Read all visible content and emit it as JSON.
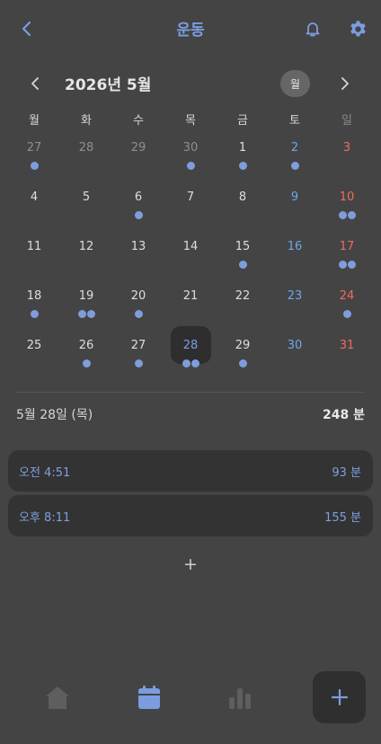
{
  "header": {
    "title": "운동",
    "back_icon": "chevron-left-icon",
    "notification_icon": "bell-icon",
    "settings_icon": "gear-icon"
  },
  "calendar": {
    "month_label": "2026년 5월",
    "view_toggle": "월",
    "weekdays": [
      "월",
      "화",
      "수",
      "목",
      "금",
      "토",
      "일"
    ],
    "weeks": [
      [
        {
          "d": "27",
          "other": true,
          "dots": 1
        },
        {
          "d": "28",
          "other": true,
          "dots": 0
        },
        {
          "d": "29",
          "other": true,
          "dots": 0
        },
        {
          "d": "30",
          "other": true,
          "dots": 1
        },
        {
          "d": "1",
          "dots": 1
        },
        {
          "d": "2",
          "dots": 1
        },
        {
          "d": "3",
          "dots": 0
        }
      ],
      [
        {
          "d": "4",
          "dots": 0
        },
        {
          "d": "5",
          "dots": 0
        },
        {
          "d": "6",
          "dots": 1
        },
        {
          "d": "7",
          "dots": 0
        },
        {
          "d": "8",
          "dots": 0
        },
        {
          "d": "9",
          "dots": 0
        },
        {
          "d": "10",
          "dots": 2
        }
      ],
      [
        {
          "d": "11",
          "dots": 0
        },
        {
          "d": "12",
          "dots": 0
        },
        {
          "d": "13",
          "dots": 0
        },
        {
          "d": "14",
          "dots": 0
        },
        {
          "d": "15",
          "dots": 1
        },
        {
          "d": "16",
          "dots": 0
        },
        {
          "d": "17",
          "dots": 2
        }
      ],
      [
        {
          "d": "18",
          "dots": 1
        },
        {
          "d": "19",
          "dots": 2
        },
        {
          "d": "20",
          "dots": 1
        },
        {
          "d": "21",
          "dots": 0
        },
        {
          "d": "22",
          "dots": 0
        },
        {
          "d": "23",
          "dots": 0
        },
        {
          "d": "24",
          "dots": 1
        }
      ],
      [
        {
          "d": "25",
          "dots": 0
        },
        {
          "d": "26",
          "dots": 1
        },
        {
          "d": "27",
          "dots": 1
        },
        {
          "d": "28",
          "dots": 2,
          "selected": true
        },
        {
          "d": "29",
          "dots": 1
        },
        {
          "d": "30",
          "dots": 0
        },
        {
          "d": "31",
          "dots": 0
        }
      ]
    ]
  },
  "summary": {
    "date": "5월 28일 (목)",
    "total": "248 분"
  },
  "entries": [
    {
      "time": "오전 4:51",
      "duration": "93 분"
    },
    {
      "time": "오후 8:11",
      "duration": "155 분"
    }
  ],
  "add_entry_label": "+",
  "nav": {
    "items": [
      "home-icon",
      "calendar-icon",
      "bar-chart-icon"
    ],
    "active": "calendar-icon",
    "fab_label": "+"
  },
  "colors": {
    "background": "#444444",
    "accent": "#7b9de0",
    "saturday": "#6aa8e6",
    "sunday": "#ef6c60",
    "card": "#333333"
  }
}
